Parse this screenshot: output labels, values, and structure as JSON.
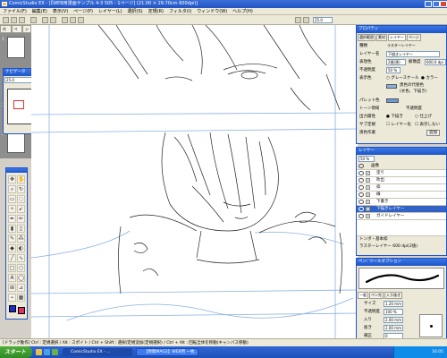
{
  "window": {
    "title": "ComicStudio EX - [【WEB用漫画サンプル 4-3 505 - 1ページ] (21.00 × 29.70cm 600dpi)]"
  },
  "menu": [
    "ファイル(F)",
    "編集(E)",
    "表示(V)",
    "ページ(P)",
    "レイヤー(L)",
    "選択(S)",
    "定規(R)",
    "フィルタ(I)",
    "ウィンドウ(W)",
    "ヘルプ(H)"
  ],
  "toolbar": {
    "zoom": "25.0"
  },
  "left_tabs": [
    "作品",
    "ペー",
    "ジ"
  ],
  "pages": [
    "1",
    "2",
    "3"
  ],
  "navigator": {
    "title": "ナビゲータ",
    "zoom": "25.0"
  },
  "properties": {
    "title": "プロパティ",
    "tabs": [
      "選択範囲",
      "素材",
      "レイヤー",
      "ページ"
    ],
    "rows": [
      {
        "label": "種類",
        "value": "ラスターレイヤー"
      },
      {
        "label": "レイヤー名",
        "value": "下描きレイヤー"
      },
      {
        "label": "表現色",
        "value": "2値(黒)"
      },
      {
        "label": "解像度",
        "value": "600.0 dpi"
      },
      {
        "label": "不透明度",
        "value": "50 %"
      },
      {
        "label": "表示色",
        "value": "グレースケール"
      },
      {
        "label": "",
        "value": "カラー"
      },
      {
        "label": "",
        "value": "黒色の代替色"
      },
      {
        "label": "",
        "value": "(水色、下描き)"
      },
      {
        "label": "パレット色",
        "value": ""
      },
      {
        "label": "トーン領域",
        "value": "不透明度"
      },
      {
        "label": "出力属性",
        "value": "下描き"
      },
      {
        "label": "",
        "value": "仕上げ"
      },
      {
        "label": "サブ定規",
        "value": "レイヤー化"
      },
      {
        "label": "",
        "value": "表示しない"
      },
      {
        "label": "演色作業",
        "value": "追加"
      }
    ]
  },
  "layers": {
    "title": "レイヤー",
    "opacity": "50 %",
    "items": [
      {
        "name": "画像",
        "type": "folder"
      },
      {
        "name": "塗り",
        "type": "layer"
      },
      {
        "name": "吹出",
        "type": "layer"
      },
      {
        "name": "枠",
        "type": "layer"
      },
      {
        "name": "線",
        "type": "layer"
      },
      {
        "name": "下書き",
        "type": "layer"
      },
      {
        "name": "下描きレイヤー",
        "type": "layer",
        "selected": true
      },
      {
        "name": "ガイドレイヤー",
        "type": "layer"
      }
    ],
    "footer": [
      "トンボ・基本枠",
      "ラスターレイヤー 600 dpi(2値)"
    ]
  },
  "tool_option": {
    "title": "ペン: ツールオプション",
    "tabs": [
      "一般",
      "ペン先",
      "入り抜き"
    ],
    "rows": [
      {
        "label": "サイズ",
        "value": "1.20 mm"
      },
      {
        "label": "不透明度",
        "value": "100 %"
      },
      {
        "label": "入り",
        "value": "2.00 mm"
      },
      {
        "label": "抜き",
        "value": "2.00 mm"
      },
      {
        "label": "補正",
        "value": "0"
      }
    ]
  },
  "status": "[ドラッグ動作] Ctrl : 定規選択 / Alt : スポイト / Ctrl + Shift : 選択/定規追加(定規選択) / Ctrl + Alt : 回転全体を移動(キャンバス移動)",
  "taskbar": {
    "start": "スタート",
    "items": [
      {
        "label": "ComicStudio EX - ...",
        "active": true
      },
      {
        "label": "【原稿MAG2】WEB用 一枚..."
      }
    ],
    "time": "16:05"
  },
  "colors": {
    "title_blue": "#2255c4",
    "selection": "#3162c4",
    "sketch": "#8ab0e0"
  }
}
